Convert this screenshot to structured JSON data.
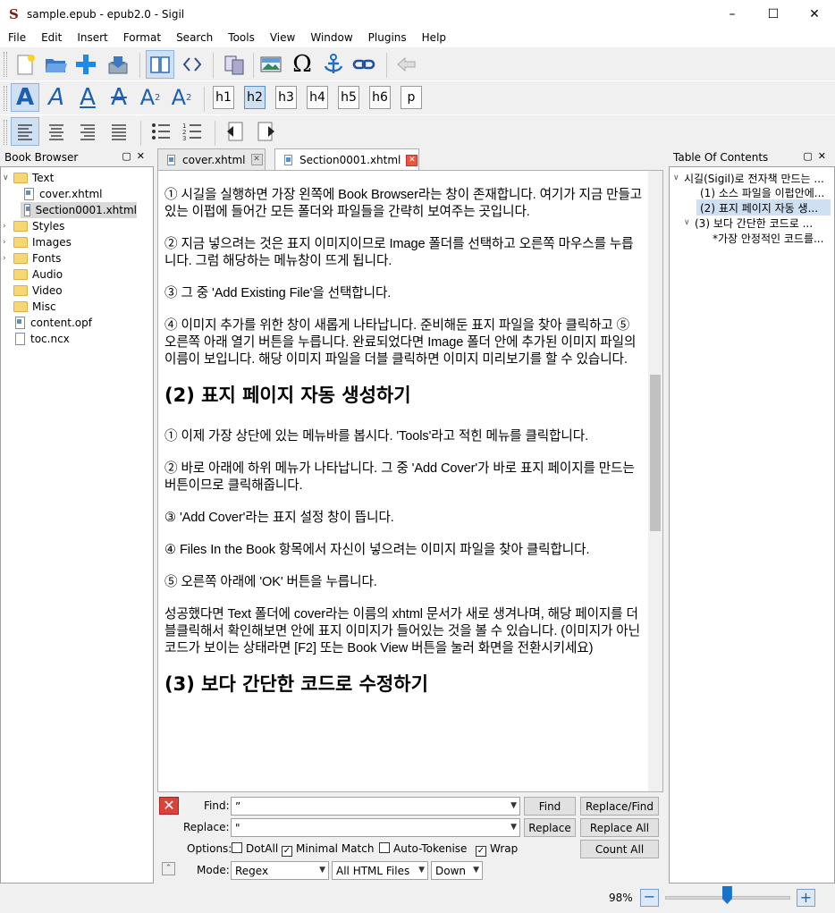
{
  "window": {
    "title": "sample.epub - epub2.0 - Sigil"
  },
  "menu": [
    "File",
    "Edit",
    "Insert",
    "Format",
    "Search",
    "Tools",
    "View",
    "Window",
    "Plugins",
    "Help"
  ],
  "heading_buttons": [
    "h1",
    "h2",
    "h3",
    "h4",
    "h5",
    "h6",
    "p"
  ],
  "book_browser": {
    "title": "Book Browser",
    "items": [
      {
        "label": "Text",
        "type": "folder",
        "expanded": true
      },
      {
        "label": "cover.xhtml",
        "type": "file"
      },
      {
        "label": "Section0001.xhtml",
        "type": "file",
        "selected": true
      },
      {
        "label": "Styles",
        "type": "folder"
      },
      {
        "label": "Images",
        "type": "folder"
      },
      {
        "label": "Fonts",
        "type": "folder"
      },
      {
        "label": "Audio",
        "type": "folder"
      },
      {
        "label": "Video",
        "type": "folder"
      },
      {
        "label": "Misc",
        "type": "folder"
      },
      {
        "label": "content.opf",
        "type": "file"
      },
      {
        "label": "toc.ncx",
        "type": "file"
      }
    ]
  },
  "tabs": [
    {
      "label": "cover.xhtml",
      "active": false
    },
    {
      "label": "Section0001.xhtml",
      "active": true
    }
  ],
  "document": {
    "p1": "① 시길을 실행하면 가장 왼쪽에 Book Browser라는 창이 존재합니다. 여기가 지금 만들고 있는 이펍에 들어간 모든 폴더와 파일들을 간략히 보여주는 곳입니다.",
    "p2": "② 지금 넣으려는 것은 표지 이미지이므로 Image 폴더를 선택하고 오른쪽 마우스를 누릅니다. 그럼 해당하는 메뉴창이 뜨게 됩니다.",
    "p3": "③ 그 중 'Add Existing File'을 선택합니다.",
    "p4": "④ 이미지 추가를 위한 창이 새롭게 나타납니다. 준비해둔 표지 파일을 찾아 클릭하고 ⑤ 오른쪽 아래 열기 버튼을 누릅니다. 완료되었다면 Image 폴더 안에 추가된 이미지 파일의 이름이 보입니다. 해당 이미지 파일을 더블 클릭하면 이미지 미리보기를 할 수 있습니다.",
    "h2a": "(2) 표지 페이지 자동 생성하기",
    "p5": "① 이제 가장 상단에 있는 메뉴바를 봅시다. 'Tools'라고 적힌 메뉴를 클릭합니다.",
    "p6": "② 바로 아래에 하위 메뉴가 나타납니다. 그 중 'Add Cover'가 바로 표지 페이지를 만드는 버튼이므로 클릭해줍니다.",
    "p7": "③ 'Add Cover'라는 표지 설정 창이 뜹니다.",
    "p8": "④ Files In the Book 항목에서 자신이 넣으려는 이미지 파일을 찾아 클릭합니다.",
    "p9": "⑤ 오른쪽 아래에 'OK' 버튼을 누릅니다.",
    "p10": "성공했다면 Text 폴더에 cover라는 이름의 xhtml 문서가 새로 생겨나며, 해당 페이지를 더블클릭해서 확인해보면 안에 표지 이미지가 들어있는 것을 볼 수 있습니다. (이미지가 아닌 코드가 보이는 상태라면 [F2] 또는 Book View 버튼을 눌러 화면을 전환시키세요)",
    "h2b": "(3) 보다 간단한 코드로 수정하기"
  },
  "toc": {
    "title": "Table Of Contents",
    "items": [
      {
        "label": "시길(Sigil)로 전자책 만드는 ..."
      },
      {
        "label": "(1) 소스 파일을 이펍안에..."
      },
      {
        "label": "(2) 표지 페이지 자동 생..."
      },
      {
        "label": "(3) 보다 간단한 코드로 ..."
      },
      {
        "label": "*가장 안정적인 코드를..."
      }
    ]
  },
  "find": {
    "find_label": "Find:",
    "find_value": "”",
    "replace_label": "Replace:",
    "replace_value": "\"",
    "options_label": "Options:",
    "dotall": "DotAll",
    "minimal_match": "Minimal Match",
    "auto_tokenise": "Auto-Tokenise",
    "wrap": "Wrap",
    "dotall_checked": false,
    "minimal_match_checked": true,
    "auto_tokenise_checked": false,
    "wrap_checked": true,
    "mode_label": "Mode:",
    "mode_value": "Regex",
    "scope_value": "All HTML Files",
    "direction_value": "Down",
    "btn_find": "Find",
    "btn_replace_find": "Replace/Find",
    "btn_replace": "Replace",
    "btn_replace_all": "Replace All",
    "btn_count_all": "Count All"
  },
  "status": {
    "zoom": "98%",
    "zoom_level": 0.98
  },
  "colors": {
    "accent": "#1a73c8",
    "selection": "#cfe0f3",
    "close_red": "#e8563d"
  }
}
